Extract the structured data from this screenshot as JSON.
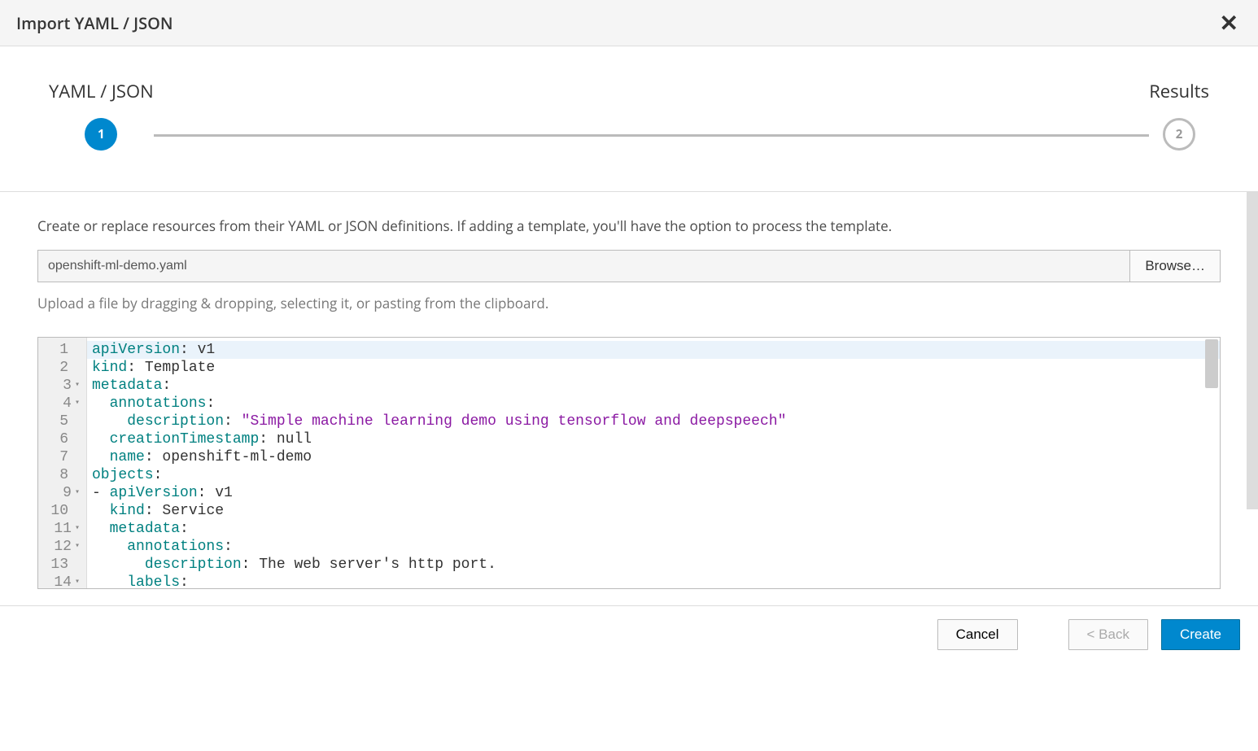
{
  "header": {
    "title": "Import YAML / JSON"
  },
  "stepper": {
    "step1_label": "YAML / JSON",
    "step1_num": "1",
    "step2_label": "Results",
    "step2_num": "2"
  },
  "body": {
    "description": "Create or replace resources from their YAML or JSON definitions. If adding a template, you'll have the option to process the template.",
    "filename": "openshift-ml-demo.yaml",
    "browse_label": "Browse…",
    "hint": "Upload a file by dragging & dropping, selecting it, or pasting from the clipboard."
  },
  "editor": {
    "lines": [
      {
        "n": "1",
        "fold": "",
        "html": "<span class='kw'>apiVersion</span>: v1"
      },
      {
        "n": "2",
        "fold": "",
        "html": "<span class='kw'>kind</span>: Template"
      },
      {
        "n": "3",
        "fold": "▾",
        "html": "<span class='kw'>metadata</span>:"
      },
      {
        "n": "4",
        "fold": "▾",
        "html": "  <span class='kw'>annotations</span>:"
      },
      {
        "n": "5",
        "fold": "",
        "html": "    <span class='kw'>description</span>: <span class='str'>\"Simple machine learning demo using tensorflow and deepspeech\"</span>"
      },
      {
        "n": "6",
        "fold": "",
        "html": "  <span class='kw'>creationTimestamp</span>: null"
      },
      {
        "n": "7",
        "fold": "",
        "html": "  <span class='kw'>name</span>: openshift-ml-demo"
      },
      {
        "n": "8",
        "fold": "",
        "html": "<span class='kw'>objects</span>:"
      },
      {
        "n": "9",
        "fold": "▾",
        "html": "- <span class='kw'>apiVersion</span>: v1"
      },
      {
        "n": "10",
        "fold": "",
        "html": "  <span class='kw'>kind</span>: Service"
      },
      {
        "n": "11",
        "fold": "▾",
        "html": "  <span class='kw'>metadata</span>:"
      },
      {
        "n": "12",
        "fold": "▾",
        "html": "    <span class='kw'>annotations</span>:"
      },
      {
        "n": "13",
        "fold": "",
        "html": "      <span class='kw'>description</span>: The web server's http port."
      },
      {
        "n": "14",
        "fold": "▾",
        "html": "    <span class='kw'>labels</span>:"
      }
    ]
  },
  "footer": {
    "cancel": "Cancel",
    "back": "< Back",
    "create": "Create"
  }
}
